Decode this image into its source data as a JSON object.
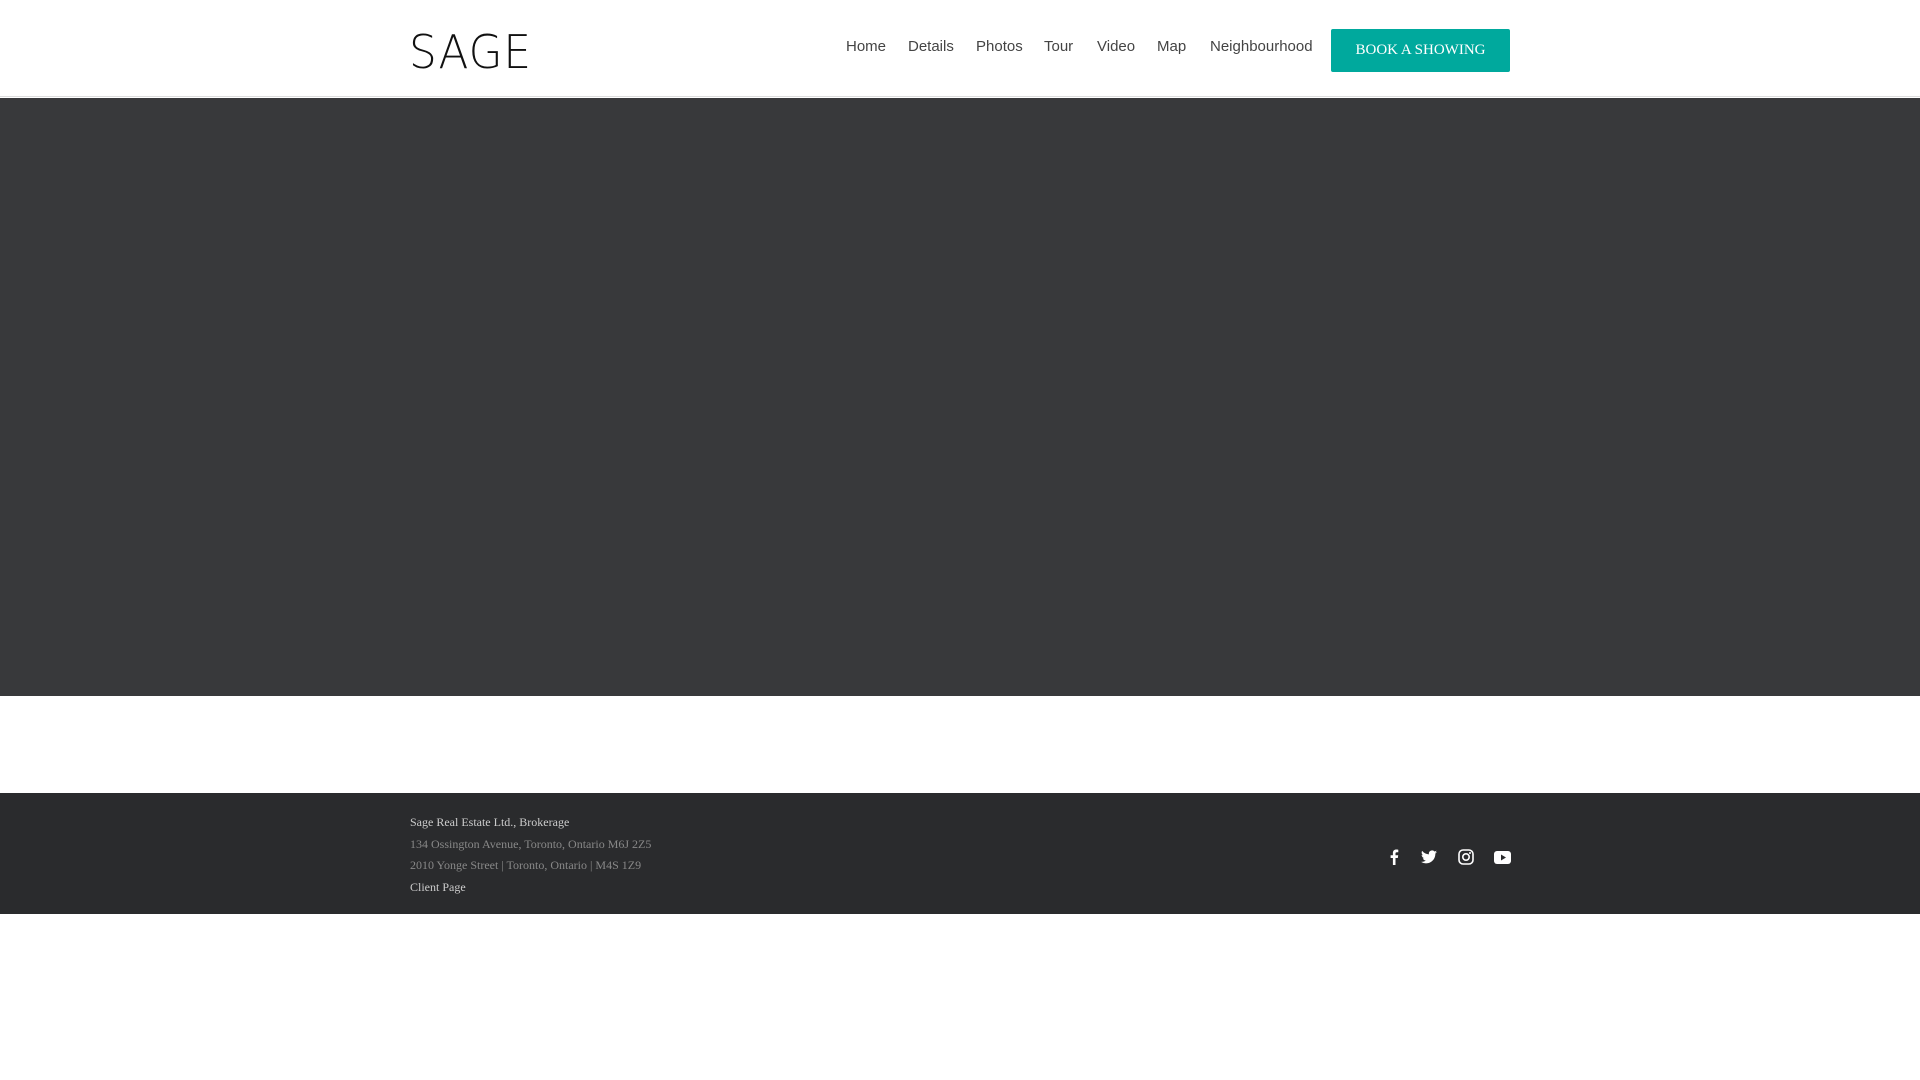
{
  "header": {
    "logo": "SAGE",
    "nav": [
      "Home",
      "Details",
      "Photos",
      "Tour",
      "Video",
      "Map",
      "Neighbourhood"
    ],
    "cta": "BOOK A SHOWING"
  },
  "footer": {
    "company": "Sage Real Estate Ltd., Brokerage",
    "address1": "134 Ossington Avenue, Toronto, Ontario M6J 2Z5",
    "address2": "2010 Yonge Street | Toronto, Ontario | M4S 1Z9",
    "client_link": "Client Page",
    "social": [
      "facebook",
      "twitter",
      "instagram",
      "youtube"
    ]
  },
  "colors": {
    "accent": "#00a99d",
    "hero": "#38393b",
    "footer": "#2a2b2d"
  }
}
